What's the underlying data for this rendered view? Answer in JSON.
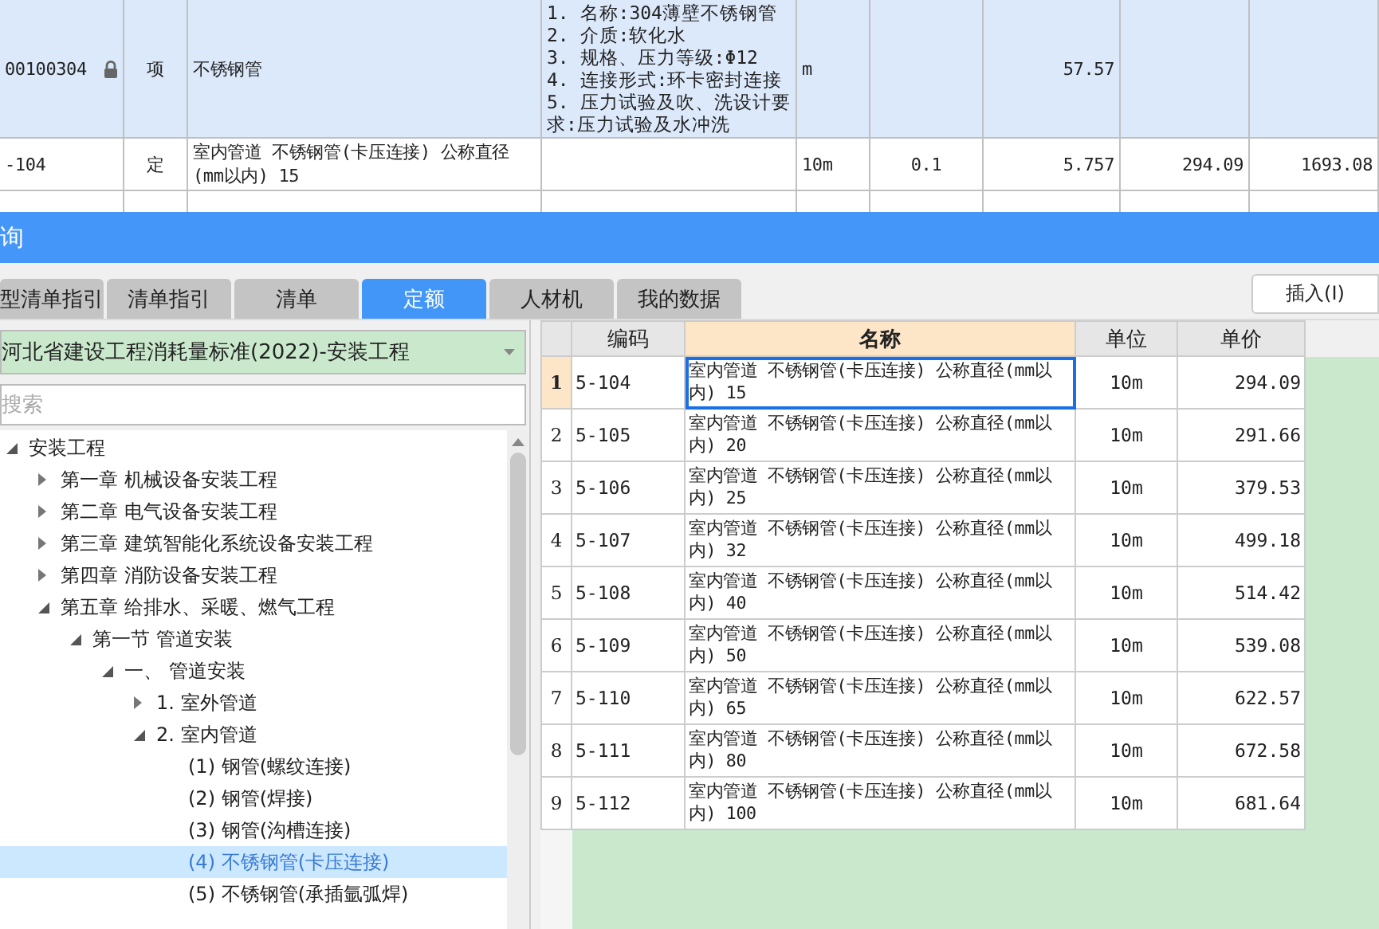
{
  "top_table": {
    "rows": [
      {
        "kind": "item",
        "locked": true,
        "cells": [
          "00100304",
          "项",
          "不锈钢管",
          [
            "1. 名称:304薄壁不锈钢管",
            "2. 介质:软化水",
            "3. 规格、压力等级:Φ12",
            "4. 连接形式:环卡密封连接",
            "5. 压力试验及吹、洗设计要求:压力试验及水冲洗"
          ],
          "m",
          null,
          "57.57",
          null,
          null
        ]
      },
      {
        "kind": "quota",
        "locked": false,
        "cells": [
          "-104",
          "定",
          "室内管道 不锈钢管(卡压连接) 公称直径(mm以内) 15",
          null,
          "10m",
          "0.1",
          "5.757",
          "294.09",
          "1693.08"
        ]
      }
    ]
  },
  "dialog": {
    "title": "询",
    "tabs": [
      {
        "label": "型清单指引",
        "selected": false
      },
      {
        "label": "清单指引",
        "selected": false
      },
      {
        "label": "清单",
        "selected": false
      },
      {
        "label": "定额",
        "selected": true
      },
      {
        "label": "人材机",
        "selected": false
      },
      {
        "label": "我的数据",
        "selected": false
      }
    ],
    "insert_button": "插入(I)",
    "library_select": "河北省建设工程消耗量标准(2022)-安装工程",
    "search": {
      "placeholder": "搜索"
    },
    "tree": [
      {
        "label": "安装工程",
        "expanded": true,
        "selected": false,
        "children": [
          {
            "label": "第一章 机械设备安装工程",
            "expanded": false,
            "selected": false
          },
          {
            "label": "第二章 电气设备安装工程",
            "expanded": false,
            "selected": false
          },
          {
            "label": "第三章 建筑智能化系统设备安装工程",
            "expanded": false,
            "selected": false
          },
          {
            "label": "第四章 消防设备安装工程",
            "expanded": false,
            "selected": false
          },
          {
            "label": "第五章 给排水、采暖、燃气工程",
            "expanded": true,
            "selected": false,
            "children": [
              {
                "label": "第一节 管道安装",
                "expanded": true,
                "selected": false,
                "children": [
                  {
                    "label": "一、 管道安装",
                    "expanded": true,
                    "selected": false,
                    "children": [
                      {
                        "label": "1. 室外管道",
                        "expanded": false,
                        "selected": false
                      },
                      {
                        "label": "2. 室内管道",
                        "expanded": true,
                        "selected": false,
                        "children": [
                          {
                            "label": "(1) 钢管(螺纹连接)",
                            "selected": false
                          },
                          {
                            "label": "(2) 钢管(焊接)",
                            "selected": false
                          },
                          {
                            "label": "(3) 钢管(沟槽连接)",
                            "selected": false
                          },
                          {
                            "label": "(4) 不锈钢管(卡压连接)",
                            "selected": true
                          },
                          {
                            "label": "(5) 不锈钢管(承插氩弧焊)",
                            "selected": false
                          }
                        ]
                      }
                    ]
                  }
                ]
              }
            ]
          }
        ]
      }
    ],
    "quota_table": {
      "columns": [
        {
          "label": "编码",
          "selected": false
        },
        {
          "label": "名称",
          "selected": true
        },
        {
          "label": "单位",
          "selected": false
        },
        {
          "label": "单价",
          "selected": false
        }
      ],
      "rows": [
        {
          "number": "1",
          "code": "5-104",
          "name": "室内管道 不锈钢管(卡压连接) 公称直径(mm以内) 15",
          "unit": "10m",
          "price": "294.09",
          "selected": true
        },
        {
          "number": "2",
          "code": "5-105",
          "name": "室内管道 不锈钢管(卡压连接) 公称直径(mm以内) 20",
          "unit": "10m",
          "price": "291.66",
          "selected": false
        },
        {
          "number": "3",
          "code": "5-106",
          "name": "室内管道 不锈钢管(卡压连接) 公称直径(mm以内) 25",
          "unit": "10m",
          "price": "379.53",
          "selected": false
        },
        {
          "number": "4",
          "code": "5-107",
          "name": "室内管道 不锈钢管(卡压连接) 公称直径(mm以内) 32",
          "unit": "10m",
          "price": "499.18",
          "selected": false
        },
        {
          "number": "5",
          "code": "5-108",
          "name": "室内管道 不锈钢管(卡压连接) 公称直径(mm以内) 40",
          "unit": "10m",
          "price": "514.42",
          "selected": false
        },
        {
          "number": "6",
          "code": "5-109",
          "name": "室内管道 不锈钢管(卡压连接) 公称直径(mm以内) 50",
          "unit": "10m",
          "price": "539.08",
          "selected": false
        },
        {
          "number": "7",
          "code": "5-110",
          "name": "室内管道 不锈钢管(卡压连接) 公称直径(mm以内) 65",
          "unit": "10m",
          "price": "622.57",
          "selected": false
        },
        {
          "number": "8",
          "code": "5-111",
          "name": "室内管道 不锈钢管(卡压连接) 公称直径(mm以内) 80",
          "unit": "10m",
          "price": "672.58",
          "selected": false
        },
        {
          "number": "9",
          "code": "5-112",
          "name": "室内管道 不锈钢管(卡压连接) 公称直径(mm以内) 100",
          "unit": "10m",
          "price": "681.64",
          "selected": false
        }
      ]
    }
  }
}
